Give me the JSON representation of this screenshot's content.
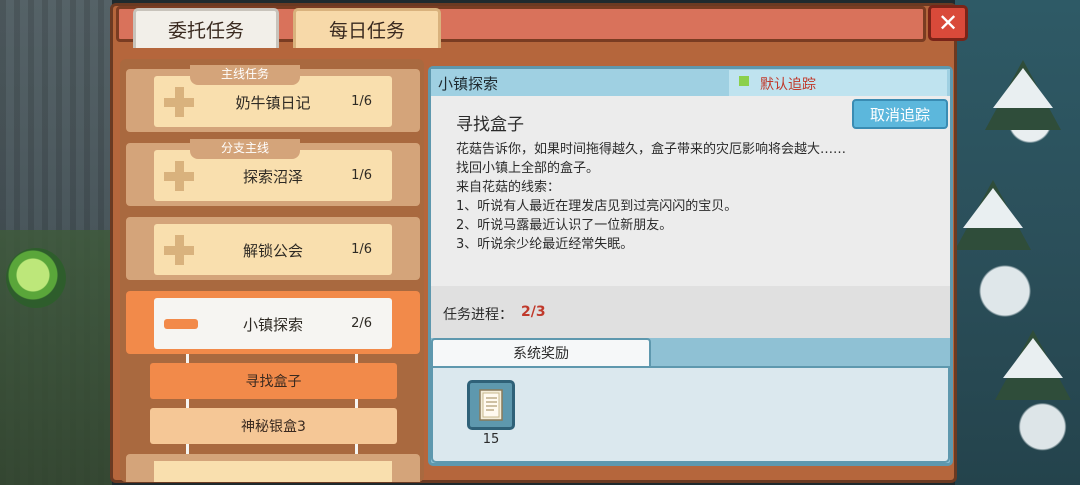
{
  "tabs": [
    {
      "label": "委托任务",
      "active": true
    },
    {
      "label": "每日任务",
      "active": false
    }
  ],
  "close_icon": "close-x-icon",
  "quest_list": [
    {
      "category": "主线任务",
      "title": "奶牛镇日记",
      "progress": "1/6"
    },
    {
      "category": "分支主线",
      "title": "探索沼泽",
      "progress": "1/6"
    },
    {
      "category": "",
      "title": "解锁公会",
      "progress": "1/6"
    },
    {
      "category": "",
      "title": "小镇探索",
      "progress": "2/6",
      "active": true
    }
  ],
  "sub_quests": [
    {
      "label": "寻找盒子",
      "active": true
    },
    {
      "label": "神秘银盒3",
      "active": false
    }
  ],
  "detail": {
    "header_title": "小镇探索",
    "track_label": "默认追踪",
    "cancel_button": "取消追踪",
    "quest_name": "寻找盒子",
    "lines": [
      "花菇告诉你，如果时间拖得越久，盒子带来的灾厄影响将会越大……",
      "找回小镇上全部的盒子。",
      "来自花菇的线索：",
      "1、听说有人最近在理发店见到过亮闪闪的宝贝。",
      "2、听说马露最近认识了一位新朋友。",
      "3、听说余少纶最近经常失眠。"
    ],
    "progress_label": "任务进程：",
    "progress_value": "2/3",
    "reward_tab": "系统奖励",
    "rewards": [
      {
        "icon": "notebook-icon",
        "count": "15"
      }
    ]
  },
  "colors": {
    "accent_orange": "#f28a4a",
    "panel_blue": "#8fc1d4",
    "progress_red": "#c0392b"
  }
}
